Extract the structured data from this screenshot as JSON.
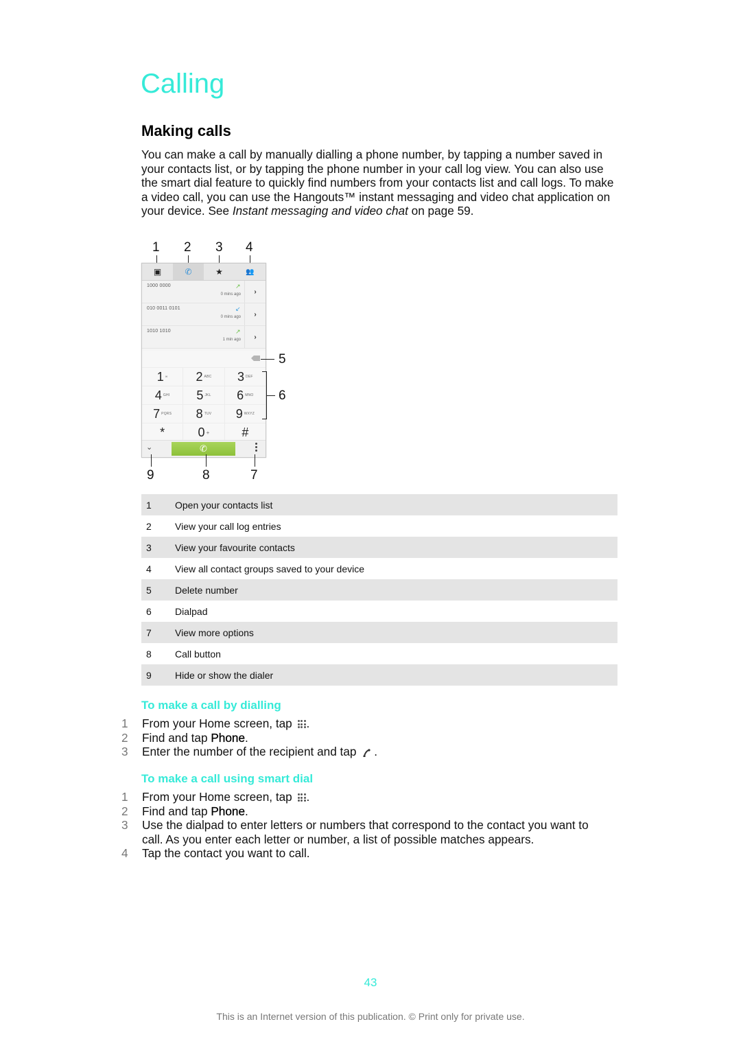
{
  "chapter_title": "Calling",
  "section_title": "Making calls",
  "intro": {
    "text_before": "You can make a call by manually dialling a phone number, by tapping a number saved in your contacts list, or by tapping the phone number in your call log view. You can also use the smart dial feature to quickly find numbers from your contacts list and call logs. To make a video call, you can use the Hangouts™ instant messaging and video chat application on your device. See ",
    "link_text": "Instant messaging and video chat",
    "text_after": " on page 59."
  },
  "figure": {
    "callouts": [
      "1",
      "2",
      "3",
      "4",
      "5",
      "6",
      "7",
      "8",
      "9"
    ],
    "tabs": [
      {
        "icon": "contacts-icon",
        "glyph": "▣"
      },
      {
        "icon": "phone-icon",
        "glyph": "✆",
        "active": true
      },
      {
        "icon": "star-icon",
        "glyph": "★"
      },
      {
        "icon": "groups-icon",
        "glyph": "👥"
      }
    ],
    "call_log": [
      {
        "number": "1000 0000",
        "time": "0 mins ago",
        "direction": "outgoing",
        "arrow": "↗",
        "arrow_color": "#6cc04a"
      },
      {
        "number": "010 0011 0101",
        "time": "0 mins ago",
        "direction": "incoming",
        "arrow": "↙",
        "arrow_color": "#3aa0e0"
      },
      {
        "number": "1010 1010",
        "time": "1 min ago",
        "direction": "outgoing",
        "arrow": "↗",
        "arrow_color": "#6cc04a"
      }
    ],
    "chevron": "›",
    "dialpad": [
      [
        {
          "digit": "1",
          "letters": "∞"
        },
        {
          "digit": "2",
          "letters": "ABC"
        },
        {
          "digit": "3",
          "letters": "DEF"
        }
      ],
      [
        {
          "digit": "4",
          "letters": "GHI"
        },
        {
          "digit": "5",
          "letters": "JKL"
        },
        {
          "digit": "6",
          "letters": "MNO"
        }
      ],
      [
        {
          "digit": "7",
          "letters": "PQRS"
        },
        {
          "digit": "8",
          "letters": "TUV"
        },
        {
          "digit": "9",
          "letters": "WXYZ"
        }
      ],
      [
        {
          "digit": "*",
          "letters": ""
        },
        {
          "digit": "0",
          "letters": "+"
        },
        {
          "digit": "#",
          "letters": ""
        }
      ]
    ],
    "collapse_glyph": "⌄",
    "call_glyph": "✆",
    "call_button_color": "#9ccb47"
  },
  "legend": [
    {
      "num": "1",
      "text": "Open your contacts list"
    },
    {
      "num": "2",
      "text": "View your call log entries"
    },
    {
      "num": "3",
      "text": "View your favourite contacts"
    },
    {
      "num": "4",
      "text": "View all contact groups saved to your device"
    },
    {
      "num": "5",
      "text": "Delete number"
    },
    {
      "num": "6",
      "text": "Dialpad"
    },
    {
      "num": "7",
      "text": "View more options"
    },
    {
      "num": "8",
      "text": "Call button"
    },
    {
      "num": "9",
      "text": "Hide or show the dialer"
    }
  ],
  "procedures": [
    {
      "title": "To make a call by dialling",
      "steps": [
        {
          "num": "1",
          "before": "From your Home screen, tap ",
          "icon": "apps-icon",
          "after": "."
        },
        {
          "num": "2",
          "before": "Find and tap ",
          "bold": "Phone",
          "after": "."
        },
        {
          "num": "3",
          "before": "Enter the number of the recipient and tap ",
          "icon": "phone-icon",
          "after": "."
        }
      ]
    },
    {
      "title": "To make a call using smart dial",
      "steps": [
        {
          "num": "1",
          "before": "From your Home screen, tap ",
          "icon": "apps-icon",
          "after": "."
        },
        {
          "num": "2",
          "before": "Find and tap ",
          "bold": "Phone",
          "after": "."
        },
        {
          "num": "3",
          "before": "Use the dialpad to enter letters or numbers that correspond to the contact you want to call. As you enter each letter or number, a list of possible matches appears.",
          "after": ""
        },
        {
          "num": "4",
          "before": "Tap the contact you want to call.",
          "after": ""
        }
      ]
    }
  ],
  "page_number": "43",
  "footer": "This is an Internet version of this publication. © Print only for private use.",
  "colors": {
    "accent": "#36ead8",
    "table_shade": "#e4e4e4"
  }
}
